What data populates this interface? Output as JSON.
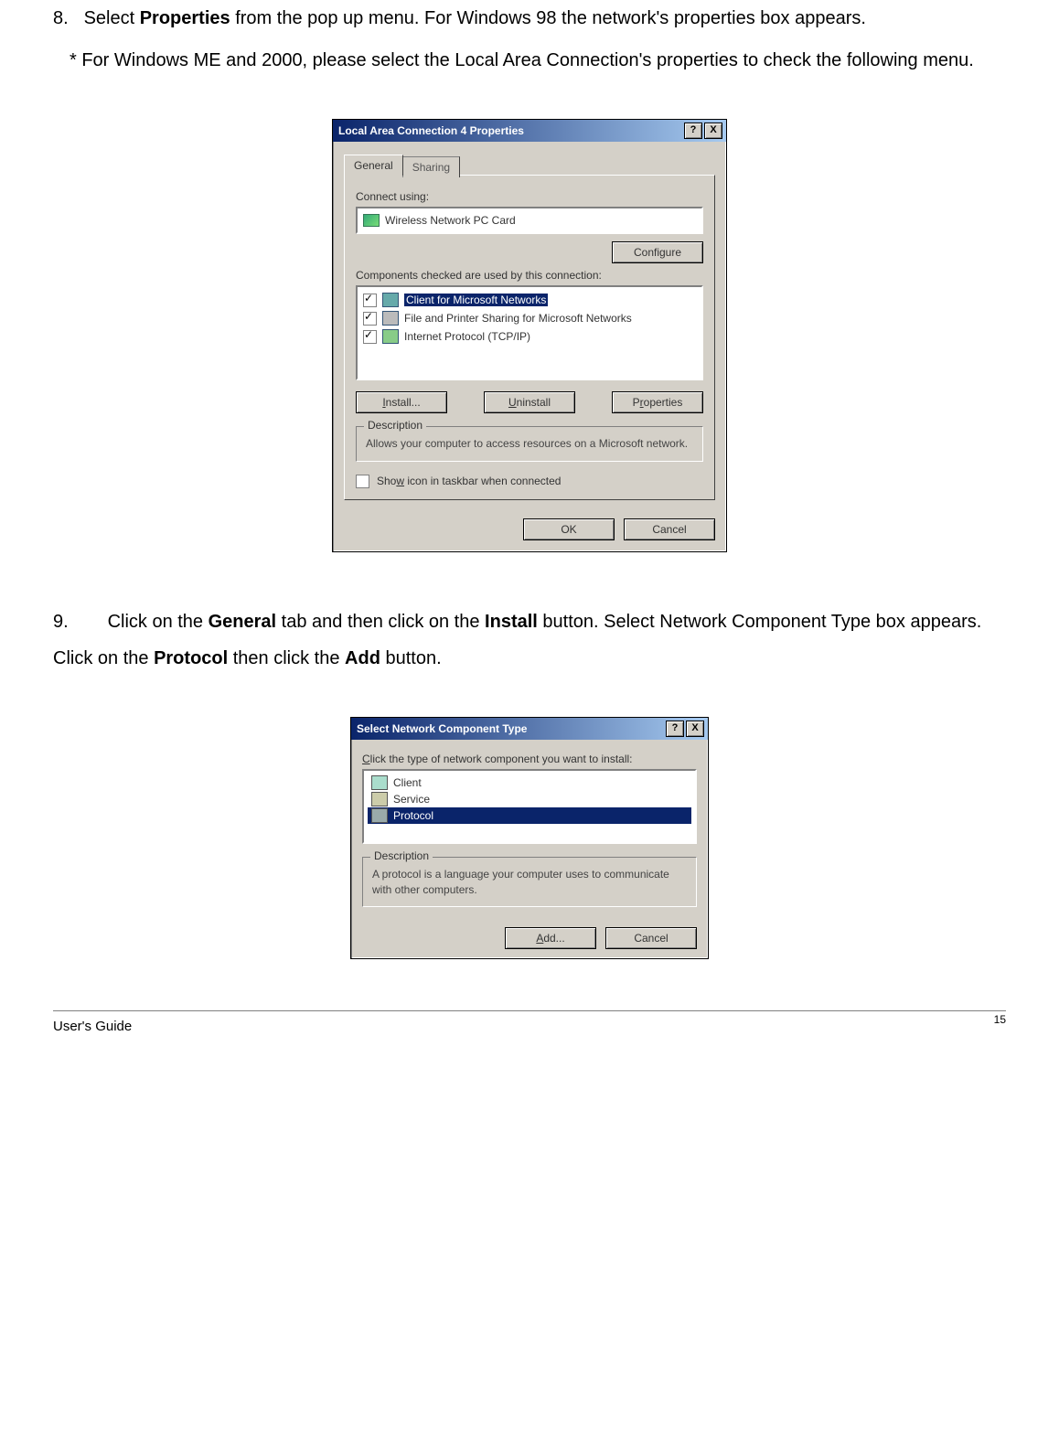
{
  "steps": {
    "s8_num": "8.",
    "s8_text_a": "Select ",
    "s8_bold_a": "Properties",
    "s8_text_b": " from the pop up menu. For Windows 98 the network's properties box appears.",
    "s8_note": "* For Windows ME and 2000, please select the Local Area Connection's properties to check the following menu.",
    "s9_num": "9.",
    "s9_text_a": "Click on the ",
    "s9_bold_a": "General",
    "s9_text_b": " tab and then click on the ",
    "s9_bold_b": "Install",
    "s9_text_c": " button. Select Network Component Type box appears. Click on the ",
    "s9_bold_c": "Protocol",
    "s9_text_d": " then click the ",
    "s9_bold_d": "Add",
    "s9_text_e": " button."
  },
  "dialog1": {
    "title": "Local Area Connection 4 Properties",
    "help": "?",
    "close": "X",
    "tabs": {
      "general": "General",
      "sharing": "Sharing"
    },
    "connect_using_label": "Connect using:",
    "adapter": "Wireless Network PC Card",
    "configure": "Configure",
    "components_label": "Components checked are used by this connection:",
    "items": [
      "Client for Microsoft Networks",
      "File and Printer Sharing for Microsoft Networks",
      "Internet Protocol (TCP/IP)"
    ],
    "install": "Install...",
    "uninstall": "Uninstall",
    "properties": "Properties",
    "desc_legend": "Description",
    "desc_text": "Allows your computer to access resources on a Microsoft network.",
    "show_icon": "Show icon in taskbar when connected",
    "ok": "OK",
    "cancel": "Cancel"
  },
  "dialog2": {
    "title": "Select Network Component Type",
    "help": "?",
    "close": "X",
    "prompt": "Click the type of network component you want to install:",
    "items": {
      "client": "Client",
      "service": "Service",
      "protocol": "Protocol"
    },
    "desc_legend": "Description",
    "desc_text": "A protocol is a language your computer uses to communicate with other computers.",
    "add": "Add...",
    "cancel": "Cancel"
  },
  "footer": {
    "guide": "User's Guide",
    "page": "15"
  }
}
